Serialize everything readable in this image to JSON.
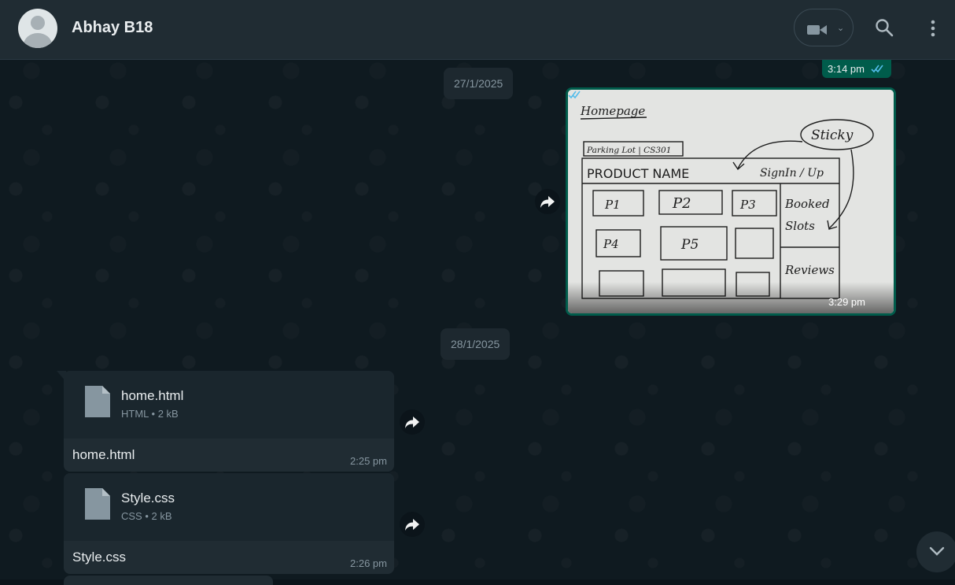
{
  "header": {
    "contact_name": "Abhay B18",
    "icons": [
      "avatar",
      "video-call-icon",
      "chevron-down-icon",
      "search-icon",
      "menu-icon"
    ]
  },
  "colors": {
    "header_bg": "#202c33",
    "chat_bg": "#0b141a",
    "outgoing_accent": "#005c4b",
    "incoming_bubble": "#202c33",
    "read_ticks": "#53bdeb",
    "secondary_text": "#8696a0"
  },
  "messages": {
    "prev_time": "3:14 pm",
    "date_1": "27/1/2025",
    "image_time": "3:29 pm",
    "date_2": "28/1/2025",
    "files": [
      {
        "name": "home.html",
        "type": "HTML",
        "size": "2 kB",
        "caption": "home.html",
        "time": "2:25 pm"
      },
      {
        "name": "Style.css",
        "type": "CSS",
        "size": "2 kB",
        "caption": "Style.css",
        "time": "2:26 pm"
      }
    ],
    "meta_separator": "•"
  },
  "sketch": {
    "title": "Homepage",
    "sticky": "Sticky",
    "subtitle": "Parking Lot | CS301",
    "product_name": "PRODUCT NAME",
    "signin": "SignIn / Up",
    "booked": "Booked",
    "slots": "Slots",
    "reviews": "Reviews",
    "tiles": [
      "P1",
      "P2",
      "P3",
      "P4",
      "P5"
    ]
  }
}
